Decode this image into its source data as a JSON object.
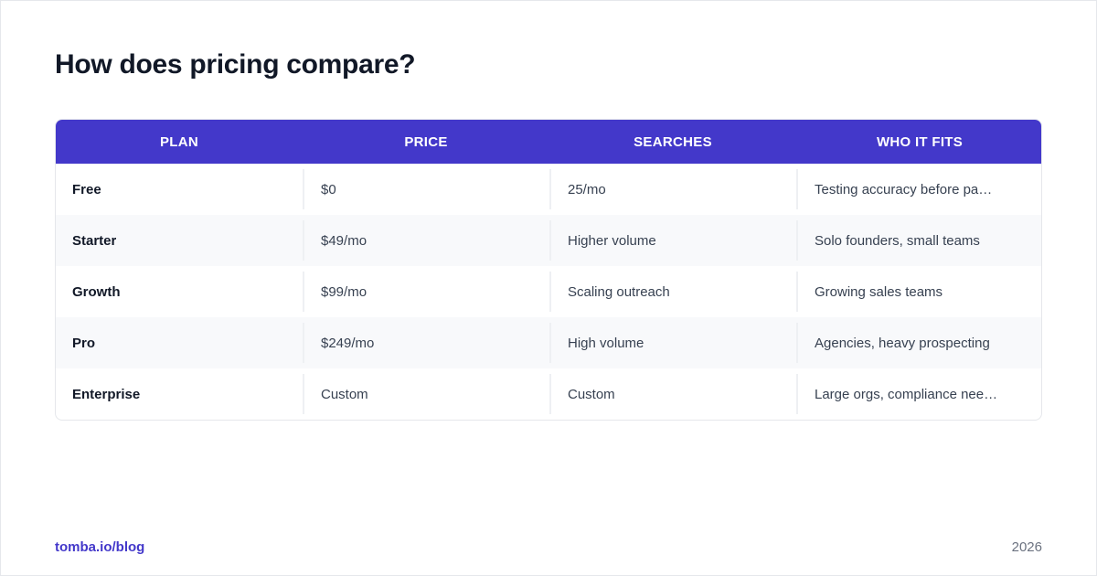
{
  "title": "How does pricing compare?",
  "colors": {
    "header_bg": "#4338ca",
    "accent": "#4338ca",
    "row_alt": "#f8f9fb"
  },
  "table": {
    "headers": [
      "PLAN",
      "PRICE",
      "SEARCHES",
      "WHO IT FITS"
    ],
    "rows": [
      [
        "Free",
        "$0",
        "25/mo",
        "Testing accuracy before pa…"
      ],
      [
        "Starter",
        "$49/mo",
        "Higher volume",
        "Solo founders, small teams"
      ],
      [
        "Growth",
        "$99/mo",
        "Scaling outreach",
        "Growing sales teams"
      ],
      [
        "Pro",
        "$249/mo",
        "High volume",
        "Agencies, heavy prospecting"
      ],
      [
        "Enterprise",
        "Custom",
        "Custom",
        "Large orgs, compliance nee…"
      ]
    ]
  },
  "footer": {
    "link": "tomba.io/blog",
    "year": "2026"
  }
}
